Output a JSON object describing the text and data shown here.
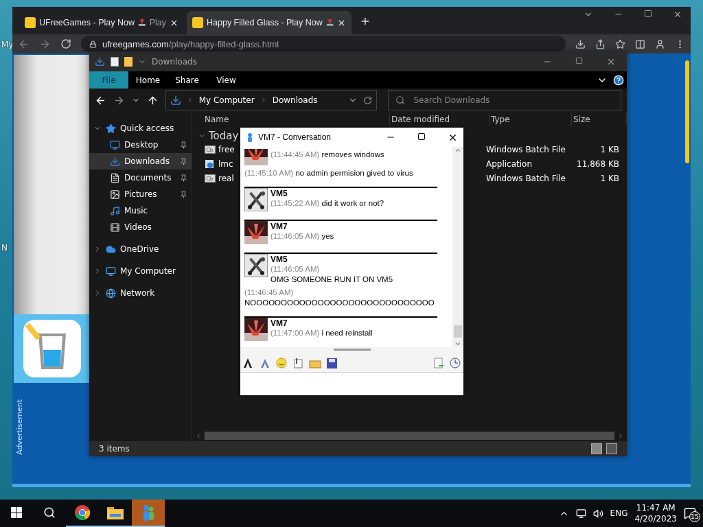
{
  "desktop": {
    "icon_labels": [
      "My",
      "N"
    ]
  },
  "browser": {
    "tabs": [
      {
        "title": "UFreeGames - Play Now",
        "tail": "Play",
        "selected": false
      },
      {
        "title": "Happy Filled Glass - Play Now",
        "selected": true
      }
    ],
    "url_domain": "ufreegames.com",
    "url_path": "/play/happy-filled-glass.html",
    "ad_label": "Advertisement"
  },
  "explorer": {
    "title": "Downloads",
    "ribbon_tabs": [
      {
        "label": "File",
        "selected": true
      },
      {
        "label": "Home",
        "selected": false
      },
      {
        "label": "Share",
        "selected": false
      },
      {
        "label": "View",
        "selected": false
      }
    ],
    "breadcrumb": [
      "My Computer",
      "Downloads"
    ],
    "search": {
      "placeholder": "Search Downloads"
    },
    "nav": [
      {
        "label": "Quick access",
        "expanded": true,
        "selected": false,
        "children": [
          {
            "label": "Desktop",
            "pinned": true,
            "selected": false
          },
          {
            "label": "Downloads",
            "pinned": true,
            "selected": true
          },
          {
            "label": "Documents",
            "pinned": true,
            "selected": false
          },
          {
            "label": "Pictures",
            "pinned": true,
            "selected": false
          },
          {
            "label": "Music",
            "pinned": false,
            "selected": false
          },
          {
            "label": "Videos",
            "pinned": false,
            "selected": false
          }
        ]
      },
      {
        "label": "OneDrive",
        "expanded": false,
        "selected": false
      },
      {
        "label": "My Computer",
        "expanded": false,
        "selected": false
      },
      {
        "label": "Network",
        "expanded": false,
        "selected": false
      }
    ],
    "columns": [
      "Name",
      "Date modified",
      "Type",
      "Size"
    ],
    "group": "Today",
    "files": [
      {
        "name": "free",
        "kind": "batch",
        "type": "Windows Batch File",
        "size": "1 KB"
      },
      {
        "name": "lmc",
        "kind": "app",
        "type": "Application",
        "size": "11,868 KB"
      },
      {
        "name": "real",
        "kind": "batch",
        "type": "Windows Batch File",
        "size": "1 KB"
      }
    ],
    "status": "3 items"
  },
  "chat": {
    "title": "VM7 - Conversation",
    "messages": [
      {
        "kind": "crane",
        "lines": [
          {
            "time": "(11:44:45 AM)",
            "text": "removes windows"
          }
        ]
      },
      {
        "kind": "plain",
        "lines": [
          {
            "time": "(11:45:10 AM)",
            "text": "no admin permision gived to virus"
          }
        ]
      },
      {
        "kind": "figure",
        "name": "VM5",
        "lines": [
          {
            "time": "(11:45:22 AM)",
            "text": "did it work or not?"
          }
        ]
      },
      {
        "kind": "crane",
        "name": "VM7",
        "lines": [
          {
            "time": "(11:46:05 AM)",
            "text": "yes"
          }
        ]
      },
      {
        "kind": "figure",
        "name": "VM5",
        "lines": [
          {
            "time": "(11:46:05 AM)",
            "text": "OMG SOMEONE RUN IT ON VM5"
          }
        ]
      },
      {
        "kind": "plain",
        "lines": [
          {
            "time": "(11:46:45 AM)",
            "text": "NOOOOOOOOOOOOOOOOOOOOOOOOOOOOOO"
          }
        ]
      },
      {
        "kind": "crane",
        "name": "VM7",
        "lines": [
          {
            "time": "(11:47:00 AM)",
            "text": "i need reinstall"
          }
        ]
      }
    ]
  },
  "taskbar": {
    "apps": [
      {
        "kind": "chrome",
        "running": true,
        "selected": false
      },
      {
        "kind": "explorer",
        "running": true,
        "selected": false
      },
      {
        "kind": "messenger",
        "running": true,
        "selected": true
      }
    ],
    "language": "ENG",
    "time": "11:47 AM",
    "date": "4/20/2023",
    "notifications": "15"
  }
}
